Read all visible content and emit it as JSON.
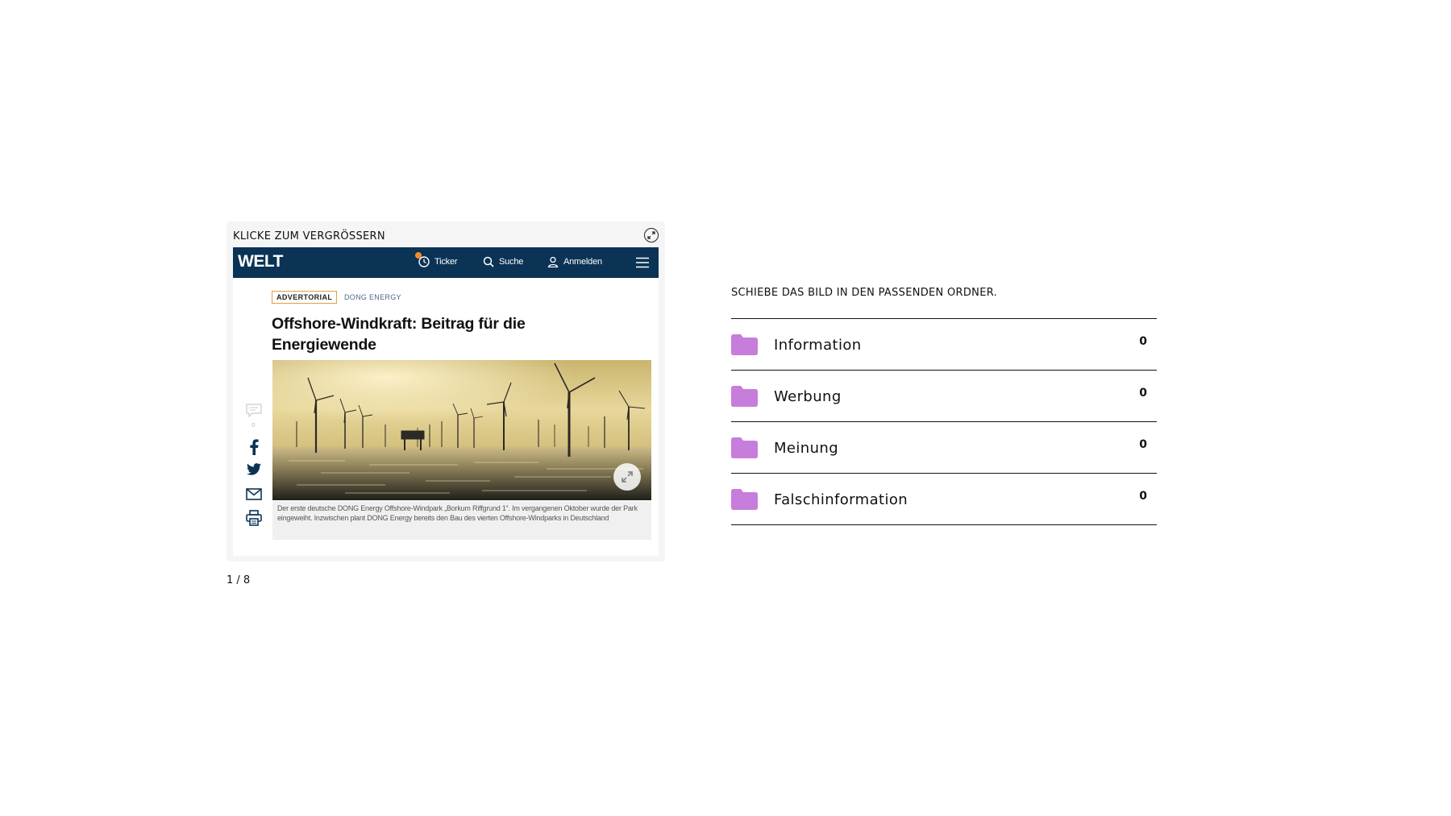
{
  "card": {
    "title": "KLICKE ZUM VERGRÖSSERN",
    "zoom_icon": "zoom-circle-icon"
  },
  "screenshot": {
    "logo": "WELT",
    "nav": {
      "ticker": "Ticker",
      "search": "Suche",
      "login": "Anmelden"
    },
    "badge": "ADVERTORIAL",
    "sponsor": "DONG ENERGY",
    "headline": "Offshore-Windkraft: Beitrag für die Energiewende",
    "caption": "Der erste deutsche DONG Energy Offshore-Windpark „Borkum Riffgrund 1“. Im vergangenen Oktober wurde der Park eingeweiht. Inzwischen plant DONG Energy bereits den Bau des vierten Offshore-Windparks in Deutschland",
    "comment_count": "0",
    "colors": {
      "nav_bg": "#0a3355",
      "badge_border": "#e0a040",
      "ticker_dot": "#f28c28"
    }
  },
  "counter": "1 / 8",
  "instruction": "SCHIEBE DAS BILD IN DEN PASSENDEN ORDNER.",
  "folders": [
    {
      "label": "Information",
      "count": "0"
    },
    {
      "label": "Werbung",
      "count": "0"
    },
    {
      "label": "Meinung",
      "count": "0"
    },
    {
      "label": "Falschinformation",
      "count": "0"
    }
  ],
  "colors": {
    "folder": "#c77ddc"
  }
}
